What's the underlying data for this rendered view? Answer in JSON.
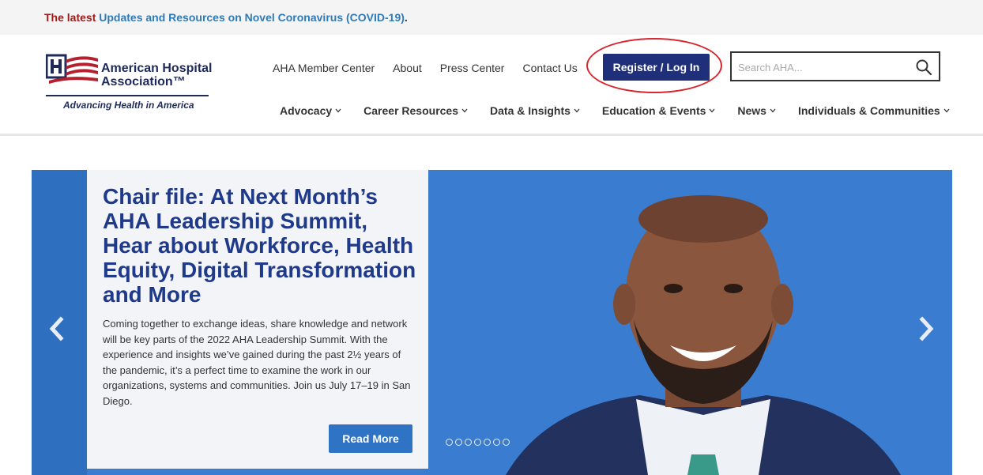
{
  "alert": {
    "lead": "The latest",
    "link_text": "Updates and Resources on Novel Coronavirus (COVID-19)",
    "trailing": "."
  },
  "logo": {
    "name_line1": "American Hospital",
    "name_line2": "Association™",
    "tagline": "Advancing Health in America"
  },
  "utility_nav": [
    {
      "label": "AHA Member Center"
    },
    {
      "label": "About"
    },
    {
      "label": "Press Center"
    },
    {
      "label": "Contact Us"
    }
  ],
  "register": {
    "label": "Register / Log In"
  },
  "search": {
    "placeholder": "Search AHA..."
  },
  "main_nav": [
    {
      "label": "Advocacy"
    },
    {
      "label": "Career Resources"
    },
    {
      "label": "Data & Insights"
    },
    {
      "label": "Education & Events"
    },
    {
      "label": "News"
    },
    {
      "label": "Individuals & Communities"
    }
  ],
  "hero": {
    "title": "Chair file: At Next Month’s AHA Leadership Summit, Hear about Workforce, Health Equity, Digital Transformation and More",
    "body": "Coming together to exchange ideas, share knowledge and network will be key parts of the 2022 AHA Leadership Summit. With the experience and insights we’ve gained during the past 2½ years of the pandemic, it’s a perfect time to examine the work in our organizations, systems and communities. Join us July 17–19 in San Diego.",
    "read_more": "Read More",
    "slide_count": 7
  },
  "colors": {
    "brand_navy": "#1f2f7a",
    "accent_red": "#9b1b1b",
    "link_blue": "#2f7ab8",
    "hero_blue": "#3a7dd0",
    "highlight_ring": "#d8262f"
  }
}
